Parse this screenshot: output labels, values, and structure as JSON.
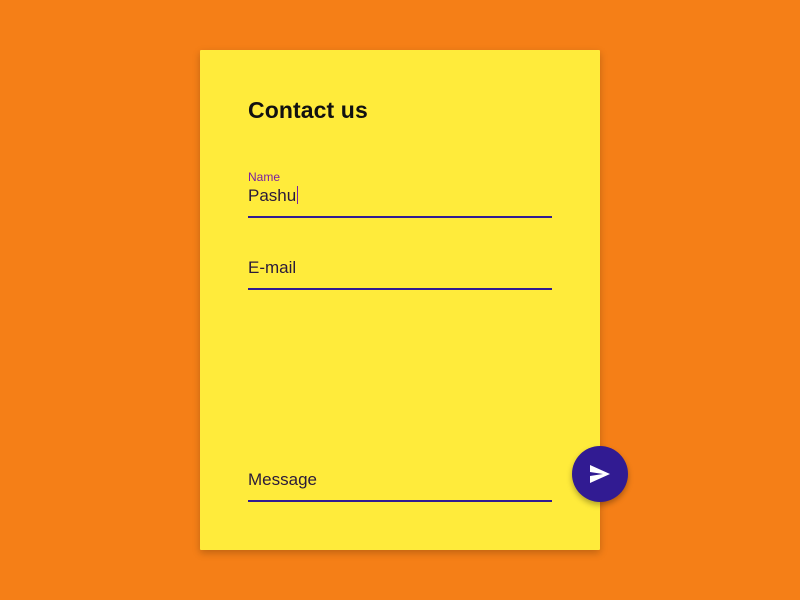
{
  "page": {
    "background_color": "#F57F17"
  },
  "card": {
    "background_color": "#FFEB3B",
    "title": "Contact us"
  },
  "form": {
    "name": {
      "label": "Name",
      "value": "Pashu"
    },
    "email": {
      "placeholder": "E-mail"
    },
    "message": {
      "placeholder": "Message"
    },
    "accent_color": "#311B92",
    "label_color": "#7B1FA2"
  },
  "send_button": {
    "icon": "send-icon",
    "color": "#311B92"
  }
}
